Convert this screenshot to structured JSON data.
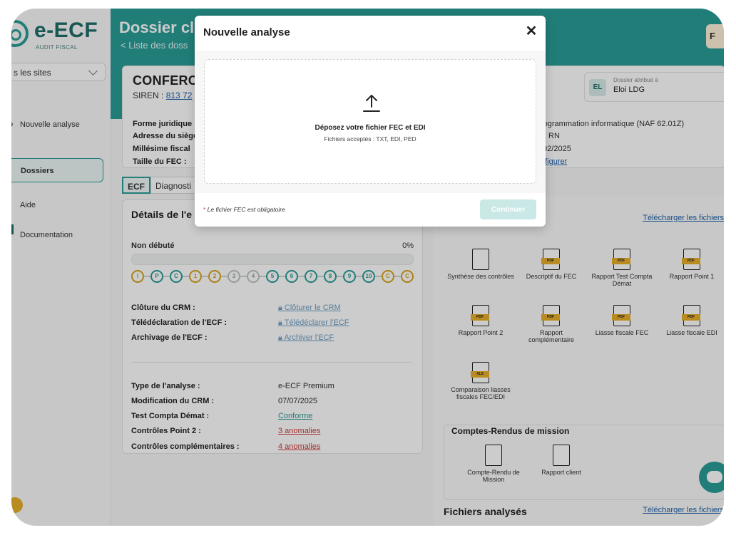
{
  "app": {
    "logo_text": "e-ECF",
    "logo_sub": "AUDIT FISCAL"
  },
  "sidebar": {
    "site_select": "s les sites",
    "items": [
      {
        "label": "Nouvelle analyse"
      },
      {
        "label": "Dossiers"
      },
      {
        "label": "Aide"
      },
      {
        "label": "Documentation"
      }
    ]
  },
  "header": {
    "title": "Dossier cl",
    "breadcrumb": "< Liste des doss",
    "user_initial": "F"
  },
  "company": {
    "name": "CONFERO",
    "siren_label": "SIREN : ",
    "siren_value": "813 72",
    "fields": [
      {
        "label": "Forme juridique",
        "value": "rogrammation informatique (NAF 62.01Z)"
      },
      {
        "label": "Adresse du siège",
        "value": "C RN"
      },
      {
        "label": "Millésime fiscal",
        "value": "/02/2025"
      },
      {
        "label": "Taille du FEC :",
        "value": "nfigurer"
      }
    ],
    "assigned_label": "Dossier attribué à",
    "assigned_name": "Eloi LDG",
    "assigned_initials": "EL"
  },
  "tabs": [
    {
      "label": "ECF"
    },
    {
      "label": "Diagnosti"
    }
  ],
  "details": {
    "title": "Détails de l'e",
    "status": "Non débuté",
    "progress": 0,
    "progress_label": "0%",
    "steps": [
      "I",
      "P",
      "C",
      "1",
      "2",
      "3",
      "4",
      "5",
      "6",
      "7",
      "8",
      "9",
      "10",
      "C",
      "C"
    ],
    "actions": [
      {
        "label": "Clôture du CRM :",
        "link": "Clôturer le CRM"
      },
      {
        "label": "Télédéclaration de l'ECF :",
        "link": "Télédéclarer l'ECF"
      },
      {
        "label": "Archivage de l'ECF :",
        "link": "Archiver l'ECF"
      }
    ],
    "info": [
      {
        "label": "Type de l'analyse :",
        "value": "e-ECF Premium"
      },
      {
        "label": "Modification du CRM :",
        "value": "07/07/2025"
      },
      {
        "label": "Test Compta Démat :",
        "value": "Conforme"
      },
      {
        "label": "Contrôles Point 2 :",
        "value": "3 anomalies"
      },
      {
        "label": "Contrôles complémentaires :",
        "value": "4 anomalies"
      }
    ]
  },
  "documents": {
    "download_label": "Télécharger les fichiers",
    "items": [
      {
        "label": "Synthèse des contrôles",
        "tag": ""
      },
      {
        "label": "Descriptif du FEC",
        "tag": "PDF"
      },
      {
        "label": "Rapport Test Compta Démat",
        "tag": "PDF"
      },
      {
        "label": "Rapport Point 1",
        "tag": "PDF"
      },
      {
        "label": "Rapport Point 2",
        "tag": "PDF"
      },
      {
        "label": "Rapport complémentaire",
        "tag": "PDF"
      },
      {
        "label": "Liasse fiscale FEC",
        "tag": "PDF"
      },
      {
        "label": "Liasse fiscale EDI",
        "tag": "PDF"
      },
      {
        "label": "Comparaison liasses fiscales FEC/EDI",
        "tag": "XLS"
      }
    ],
    "cr_title": "Comptes-Rendus de mission",
    "cr_items": [
      {
        "label": "Compte-Rendu de Mission"
      },
      {
        "label": "Rapport client"
      }
    ],
    "files_title": "Fichiers analysés",
    "files_download": "Télécharger les fichiers"
  },
  "modal": {
    "title": "Nouvelle analyse",
    "close": "✕",
    "dropzone_title": "Déposez votre fichier FEC et EDI",
    "dropzone_sub": "Fichiers acceptés : TXT, EDI, PED",
    "required_star": "*",
    "required_text": " Le fichier FEC est obligatoire",
    "continue_label": "Continuer"
  }
}
